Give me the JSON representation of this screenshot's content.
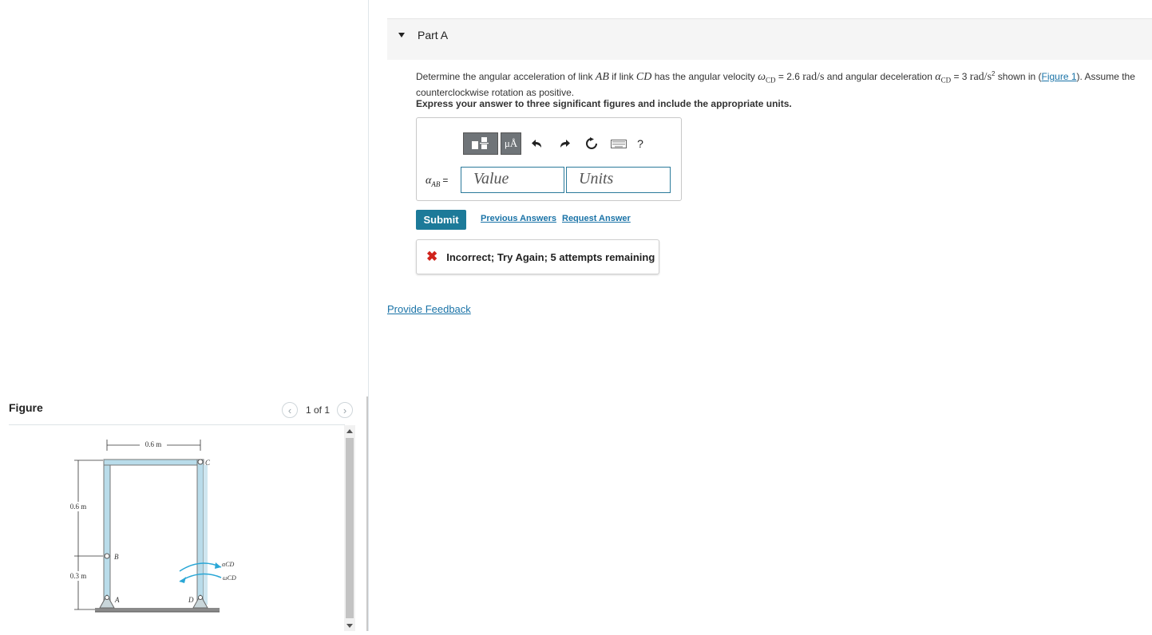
{
  "figure": {
    "title": "Figure",
    "counter": "1 of 1",
    "labels": {
      "top_width": "0.6 m",
      "left_upper": "0.6 m",
      "left_lower": "0.3 m",
      "point_a": "A",
      "point_b": "B",
      "point_c": "C",
      "point_d": "D",
      "alpha_cd": "αCD",
      "omega_cd": "ωCD"
    }
  },
  "part": {
    "title": "Part A",
    "question": {
      "pre": "Determine the angular acceleration of link ",
      "ab": "AB",
      "mid1": " if link ",
      "cd": "CD",
      "mid2": " has the angular velocity ",
      "omega": "ω",
      "omega_sub": "CD",
      "omega_val": " = 2.6 ",
      "omega_unit": "rad/s",
      "mid3": " and angular deceleration ",
      "alpha": "α",
      "alpha_sub": "CD",
      "alpha_val": " = 3 ",
      "alpha_unit": "rad/s",
      "alpha_unit_exp": "2",
      "mid4": " shown in (",
      "figure_link": "Figure 1",
      "post": "). Assume the counterclockwise rotation as positive."
    },
    "instruction": "Express your answer to three significant figures and include the appropriate units.",
    "toolbar": {
      "mu_label": "μÅ",
      "help_label": "?"
    },
    "answer": {
      "label_alpha": "α",
      "label_sub": "AB",
      "label_eq": "=",
      "value_placeholder": "Value",
      "units_placeholder": "Units"
    },
    "submit_label": "Submit",
    "previous_answers": "Previous Answers",
    "request_answer": "Request Answer",
    "feedback_text": "Incorrect; Try Again; 5 attempts remaining",
    "provide_feedback": "Provide Feedback"
  },
  "colors": {
    "accent": "#1c7a99",
    "link": "#1a73a7",
    "error": "#d0231c",
    "frame_fill": "#b9dcea"
  },
  "icons": [
    "chevron-left-icon",
    "chevron-right-icon",
    "template-icon",
    "undo-icon",
    "redo-icon",
    "reset-icon",
    "keyboard-icon",
    "help-icon",
    "x-icon"
  ]
}
